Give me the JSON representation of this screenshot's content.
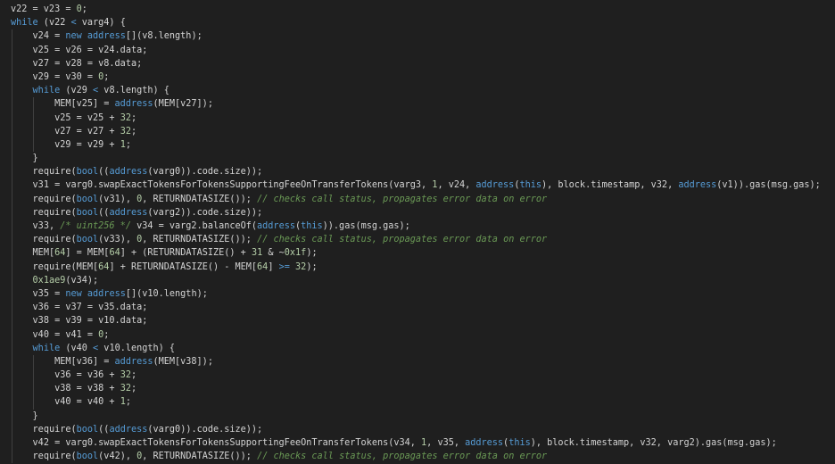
{
  "editor": {
    "lines": [
      {
        "indent": 0,
        "tokens": [
          [
            "id",
            "v22 = v23 = "
          ],
          [
            "num",
            "0"
          ],
          [
            "op",
            ";"
          ]
        ]
      },
      {
        "indent": 0,
        "tokens": [
          [
            "kw",
            "while"
          ],
          [
            "op",
            " (v22 "
          ],
          [
            "kw",
            "<"
          ],
          [
            "op",
            " varg4) {"
          ]
        ]
      },
      {
        "indent": 1,
        "tokens": [
          [
            "id",
            "v24 = "
          ],
          [
            "kw",
            "new"
          ],
          [
            "op",
            " "
          ],
          [
            "type",
            "address"
          ],
          [
            "op",
            "[](v8.length);"
          ]
        ]
      },
      {
        "indent": 1,
        "tokens": [
          [
            "id",
            "v25 = v26 = v24.data;"
          ]
        ]
      },
      {
        "indent": 1,
        "tokens": [
          [
            "id",
            "v27 = v28 = v8.data;"
          ]
        ]
      },
      {
        "indent": 1,
        "tokens": [
          [
            "id",
            "v29 = v30 = "
          ],
          [
            "num",
            "0"
          ],
          [
            "op",
            ";"
          ]
        ]
      },
      {
        "indent": 1,
        "tokens": [
          [
            "kw",
            "while"
          ],
          [
            "op",
            " (v29 "
          ],
          [
            "kw",
            "<"
          ],
          [
            "op",
            " v8.length) {"
          ]
        ]
      },
      {
        "indent": 2,
        "tokens": [
          [
            "id",
            "MEM[v25] = "
          ],
          [
            "type",
            "address"
          ],
          [
            "op",
            "(MEM[v27]);"
          ]
        ]
      },
      {
        "indent": 2,
        "tokens": [
          [
            "id",
            "v25 = v25 + "
          ],
          [
            "num",
            "32"
          ],
          [
            "op",
            ";"
          ]
        ]
      },
      {
        "indent": 2,
        "tokens": [
          [
            "id",
            "v27 = v27 + "
          ],
          [
            "num",
            "32"
          ],
          [
            "op",
            ";"
          ]
        ]
      },
      {
        "indent": 2,
        "tokens": [
          [
            "id",
            "v29 = v29 + "
          ],
          [
            "num",
            "1"
          ],
          [
            "op",
            ";"
          ]
        ]
      },
      {
        "indent": 1,
        "tokens": [
          [
            "op",
            "}"
          ]
        ]
      },
      {
        "indent": 1,
        "tokens": [
          [
            "id",
            "require("
          ],
          [
            "type",
            "bool"
          ],
          [
            "op",
            "(("
          ],
          [
            "type",
            "address"
          ],
          [
            "op",
            "(varg0)).code.size));"
          ]
        ]
      },
      {
        "indent": 1,
        "tokens": [
          [
            "id",
            "v31 = varg0.swapExactTokensForTokensSupportingFeeOnTransferTokens(varg3, "
          ],
          [
            "num",
            "1"
          ],
          [
            "op",
            ", v24, "
          ],
          [
            "type",
            "address"
          ],
          [
            "op",
            "("
          ],
          [
            "kw",
            "this"
          ],
          [
            "op",
            "), block.timestamp, v32, "
          ],
          [
            "type",
            "address"
          ],
          [
            "op",
            "(v1)).gas(msg.gas);"
          ]
        ]
      },
      {
        "indent": 1,
        "tokens": [
          [
            "id",
            "require("
          ],
          [
            "type",
            "bool"
          ],
          [
            "op",
            "(v31), "
          ],
          [
            "num",
            "0"
          ],
          [
            "op",
            ", RETURNDATASIZE()); "
          ],
          [
            "cm",
            "// checks call status, propagates error data on error"
          ]
        ]
      },
      {
        "indent": 1,
        "tokens": [
          [
            "id",
            "require("
          ],
          [
            "type",
            "bool"
          ],
          [
            "op",
            "(("
          ],
          [
            "type",
            "address"
          ],
          [
            "op",
            "(varg2)).code.size));"
          ]
        ]
      },
      {
        "indent": 1,
        "tokens": [
          [
            "id",
            "v33, "
          ],
          [
            "cm",
            "/* uint256 */"
          ],
          [
            "op",
            " v34 = varg2.balanceOf("
          ],
          [
            "type",
            "address"
          ],
          [
            "op",
            "("
          ],
          [
            "kw",
            "this"
          ],
          [
            "op",
            ")).gas(msg.gas);"
          ]
        ]
      },
      {
        "indent": 1,
        "tokens": [
          [
            "id",
            "require("
          ],
          [
            "type",
            "bool"
          ],
          [
            "op",
            "(v33), "
          ],
          [
            "num",
            "0"
          ],
          [
            "op",
            ", RETURNDATASIZE()); "
          ],
          [
            "cm",
            "// checks call status, propagates error data on error"
          ]
        ]
      },
      {
        "indent": 1,
        "tokens": [
          [
            "id",
            "MEM["
          ],
          [
            "num",
            "64"
          ],
          [
            "op",
            "] = MEM["
          ],
          [
            "num",
            "64"
          ],
          [
            "op",
            "] + (RETURNDATASIZE() + "
          ],
          [
            "num",
            "31"
          ],
          [
            "op",
            " & ~"
          ],
          [
            "num",
            "0x1f"
          ],
          [
            "op",
            ");"
          ]
        ]
      },
      {
        "indent": 1,
        "tokens": [
          [
            "id",
            "require(MEM["
          ],
          [
            "num",
            "64"
          ],
          [
            "op",
            "] + RETURNDATASIZE() - MEM["
          ],
          [
            "num",
            "64"
          ],
          [
            "op",
            "] "
          ],
          [
            "kw",
            ">="
          ],
          [
            "op",
            " "
          ],
          [
            "num",
            "32"
          ],
          [
            "op",
            ");"
          ]
        ]
      },
      {
        "indent": 1,
        "tokens": [
          [
            "num",
            "0x1ae9"
          ],
          [
            "op",
            "(v34);"
          ]
        ]
      },
      {
        "indent": 1,
        "tokens": [
          [
            "id",
            "v35 = "
          ],
          [
            "kw",
            "new"
          ],
          [
            "op",
            " "
          ],
          [
            "type",
            "address"
          ],
          [
            "op",
            "[](v10.length);"
          ]
        ]
      },
      {
        "indent": 1,
        "tokens": [
          [
            "id",
            "v36 = v37 = v35.data;"
          ]
        ]
      },
      {
        "indent": 1,
        "tokens": [
          [
            "id",
            "v38 = v39 = v10.data;"
          ]
        ]
      },
      {
        "indent": 1,
        "tokens": [
          [
            "id",
            "v40 = v41 = "
          ],
          [
            "num",
            "0"
          ],
          [
            "op",
            ";"
          ]
        ]
      },
      {
        "indent": 1,
        "tokens": [
          [
            "kw",
            "while"
          ],
          [
            "op",
            " (v40 "
          ],
          [
            "kw",
            "<"
          ],
          [
            "op",
            " v10.length) {"
          ]
        ]
      },
      {
        "indent": 2,
        "tokens": [
          [
            "id",
            "MEM[v36] = "
          ],
          [
            "type",
            "address"
          ],
          [
            "op",
            "(MEM[v38]);"
          ]
        ]
      },
      {
        "indent": 2,
        "tokens": [
          [
            "id",
            "v36 = v36 + "
          ],
          [
            "num",
            "32"
          ],
          [
            "op",
            ";"
          ]
        ]
      },
      {
        "indent": 2,
        "tokens": [
          [
            "id",
            "v38 = v38 + "
          ],
          [
            "num",
            "32"
          ],
          [
            "op",
            ";"
          ]
        ]
      },
      {
        "indent": 2,
        "tokens": [
          [
            "id",
            "v40 = v40 + "
          ],
          [
            "num",
            "1"
          ],
          [
            "op",
            ";"
          ]
        ]
      },
      {
        "indent": 1,
        "tokens": [
          [
            "op",
            "}"
          ]
        ]
      },
      {
        "indent": 1,
        "tokens": [
          [
            "id",
            "require("
          ],
          [
            "type",
            "bool"
          ],
          [
            "op",
            "(("
          ],
          [
            "type",
            "address"
          ],
          [
            "op",
            "(varg0)).code.size));"
          ]
        ]
      },
      {
        "indent": 1,
        "tokens": [
          [
            "id",
            "v42 = varg0.swapExactTokensForTokensSupportingFeeOnTransferTokens(v34, "
          ],
          [
            "num",
            "1"
          ],
          [
            "op",
            ", v35, "
          ],
          [
            "type",
            "address"
          ],
          [
            "op",
            "("
          ],
          [
            "kw",
            "this"
          ],
          [
            "op",
            "), block.timestamp, v32, varg2).gas(msg.gas);"
          ]
        ]
      },
      {
        "indent": 1,
        "tokens": [
          [
            "id",
            "require("
          ],
          [
            "type",
            "bool"
          ],
          [
            "op",
            "(v42), "
          ],
          [
            "num",
            "0"
          ],
          [
            "op",
            ", RETURNDATASIZE()); "
          ],
          [
            "cm",
            "// checks call status, propagates error data on error"
          ]
        ]
      }
    ]
  },
  "colors": {
    "background": "#1f1f1f",
    "keyword": "#569cd6",
    "number": "#b5cea8",
    "comment": "#6a9955",
    "text": "#d4d4d4"
  }
}
